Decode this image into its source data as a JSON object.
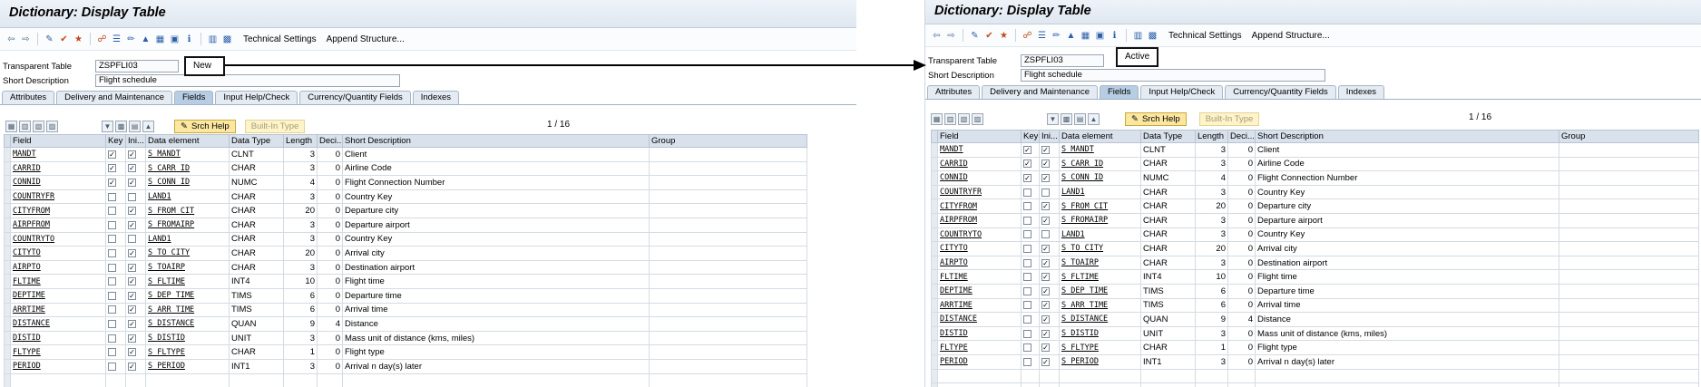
{
  "window_title": "Dictionary: Display Table",
  "toolbar": {
    "technical_settings": "Technical Settings",
    "append_structure": "Append Structure..."
  },
  "header": {
    "transparent_table_label": "Transparent Table",
    "table_name": "ZSPFLI03",
    "short_description_label": "Short Description",
    "short_description": "Flight schedule"
  },
  "status": {
    "left": "New",
    "right": "Active"
  },
  "tabs": [
    "Attributes",
    "Delivery and Maintenance",
    "Fields",
    "Input Help/Check",
    "Currency/Quantity Fields",
    "Indexes"
  ],
  "active_tab": "Fields",
  "buttons": {
    "srch_help": "Srch Help",
    "built_in_type": "Built-In Type"
  },
  "pager": "1  /  16",
  "columns": [
    "Field",
    "Key",
    "Ini...",
    "Data element",
    "Data Type",
    "Length",
    "Deci...",
    "Short Description",
    "Group"
  ],
  "left_rows": [
    {
      "field": "MANDT",
      "key": true,
      "ini": true,
      "de": "S_MANDT",
      "type": "CLNT",
      "len": "3",
      "dec": "0",
      "desc": "Client"
    },
    {
      "field": "CARRID",
      "key": true,
      "ini": true,
      "de": "S_CARR_ID",
      "type": "CHAR",
      "len": "3",
      "dec": "0",
      "desc": "Airline Code"
    },
    {
      "field": "CONNID",
      "key": true,
      "ini": true,
      "de": "S_CONN_ID",
      "type": "NUMC",
      "len": "4",
      "dec": "0",
      "desc": "Flight Connection Number"
    },
    {
      "field": "COUNTRYFR",
      "key": false,
      "ini": false,
      "de": "LAND1",
      "type": "CHAR",
      "len": "3",
      "dec": "0",
      "desc": "Country Key"
    },
    {
      "field": "CITYFROM",
      "key": false,
      "ini": true,
      "de": "S_FROM_CIT",
      "type": "CHAR",
      "len": "20",
      "dec": "0",
      "desc": "Departure city"
    },
    {
      "field": "AIRPFROM",
      "key": false,
      "ini": true,
      "de": "S_FROMAIRP",
      "type": "CHAR",
      "len": "3",
      "dec": "0",
      "desc": "Departure airport"
    },
    {
      "field": "COUNTRYTO",
      "key": false,
      "ini": false,
      "de": "LAND1",
      "type": "CHAR",
      "len": "3",
      "dec": "0",
      "desc": "Country Key"
    },
    {
      "field": "CITYTO",
      "key": false,
      "ini": true,
      "de": "S_TO_CITY",
      "type": "CHAR",
      "len": "20",
      "dec": "0",
      "desc": "Arrival city"
    },
    {
      "field": "AIRPTO",
      "key": false,
      "ini": true,
      "de": "S_TOAIRP",
      "type": "CHAR",
      "len": "3",
      "dec": "0",
      "desc": "Destination airport"
    },
    {
      "field": "FLTIME",
      "key": false,
      "ini": true,
      "de": "S_FLTIME",
      "type": "INT4",
      "len": "10",
      "dec": "0",
      "desc": "Flight time"
    },
    {
      "field": "DEPTIME",
      "key": false,
      "ini": true,
      "de": "S_DEP_TIME",
      "type": "TIMS",
      "len": "6",
      "dec": "0",
      "desc": "Departure time"
    },
    {
      "field": "ARRTIME",
      "key": false,
      "ini": true,
      "de": "S_ARR_TIME",
      "type": "TIMS",
      "len": "6",
      "dec": "0",
      "desc": "Arrival time"
    },
    {
      "field": "DISTANCE",
      "key": false,
      "ini": true,
      "de": "S_DISTANCE",
      "type": "QUAN",
      "len": "9",
      "dec": "4",
      "desc": "Distance"
    },
    {
      "field": "DISTID",
      "key": false,
      "ini": true,
      "de": "S_DISTID",
      "type": "UNIT",
      "len": "3",
      "dec": "0",
      "desc": "Mass unit of distance (kms, miles)"
    },
    {
      "field": "FLTYPE",
      "key": false,
      "ini": true,
      "de": "S_FLTYPE",
      "type": "CHAR",
      "len": "1",
      "dec": "0",
      "desc": "Flight type"
    },
    {
      "field": "PERIOD",
      "key": false,
      "ini": true,
      "de": "S_PERIOD",
      "type": "INT1",
      "len": "3",
      "dec": "0",
      "desc": "Arrival n day(s) later"
    }
  ],
  "right_rows": [
    {
      "field": "MANDT",
      "key": true,
      "ini": true,
      "de": "S_MANDT",
      "type": "CLNT",
      "len": "3",
      "dec": "0",
      "desc": "Client"
    },
    {
      "field": "CARRID",
      "key": true,
      "ini": true,
      "de": "S_CARR_ID",
      "type": "CHAR",
      "len": "3",
      "dec": "0",
      "desc": "Airline Code"
    },
    {
      "field": "CONNID",
      "key": true,
      "ini": true,
      "de": "S_CONN_ID",
      "type": "NUMC",
      "len": "4",
      "dec": "0",
      "desc": "Flight Connection Number"
    },
    {
      "field": "COUNTRYFR",
      "key": false,
      "ini": false,
      "de": "LAND1",
      "type": "CHAR",
      "len": "3",
      "dec": "0",
      "desc": "Country Key"
    },
    {
      "field": "CITYFROM",
      "key": false,
      "ini": true,
      "de": "S_FROM_CIT",
      "type": "CHAR",
      "len": "20",
      "dec": "0",
      "desc": "Departure city"
    },
    {
      "field": "AIRPFROM",
      "key": false,
      "ini": true,
      "de": "S_FROMAIRP",
      "type": "CHAR",
      "len": "3",
      "dec": "0",
      "desc": "Departure airport"
    },
    {
      "field": "COUNTRYTO",
      "key": false,
      "ini": false,
      "de": "LAND1",
      "type": "CHAR",
      "len": "3",
      "dec": "0",
      "desc": "Country Key"
    },
    {
      "field": "CITYTO",
      "key": false,
      "ini": true,
      "de": "S_TO_CITY",
      "type": "CHAR",
      "len": "20",
      "dec": "0",
      "desc": "Arrival city"
    },
    {
      "field": "AIRPTO",
      "key": false,
      "ini": true,
      "de": "S_TOAIRP",
      "type": "CHAR",
      "len": "3",
      "dec": "0",
      "desc": "Destination airport"
    },
    {
      "field": "FLTIME",
      "key": false,
      "ini": true,
      "de": "S_FLTIME",
      "type": "INT4",
      "len": "10",
      "dec": "0",
      "desc": "Flight time"
    },
    {
      "field": "DEPTIME",
      "key": false,
      "ini": true,
      "de": "S_DEP_TIME",
      "type": "TIMS",
      "len": "6",
      "dec": "0",
      "desc": "Departure time"
    },
    {
      "field": "ARRTIME",
      "key": false,
      "ini": true,
      "de": "S_ARR_TIME",
      "type": "TIMS",
      "len": "6",
      "dec": "0",
      "desc": "Arrival time"
    },
    {
      "field": "DISTANCE",
      "key": false,
      "ini": true,
      "de": "S_DISTANCE",
      "type": "QUAN",
      "len": "9",
      "dec": "4",
      "desc": "Distance"
    },
    {
      "field": "DISTID",
      "key": false,
      "ini": true,
      "de": "S_DISTID",
      "type": "UNIT",
      "len": "3",
      "dec": "0",
      "desc": "Mass unit of distance (kms, miles)"
    },
    {
      "field": "FLTYPE",
      "key": false,
      "ini": true,
      "de": "S_FLTYPE",
      "type": "CHAR",
      "len": "1",
      "dec": "0",
      "desc": "Flight type"
    },
    {
      "field": "PERIOD",
      "key": false,
      "ini": true,
      "de": "S_PERIOD",
      "type": "INT1",
      "len": "3",
      "dec": "0",
      "desc": "Arrival n day(s) later"
    }
  ],
  "colors": {
    "title_bg": "#dfe7f0",
    "tab_active": "#b7cde3",
    "button_yellow": "#fbe7a0",
    "header_row": "#d9e2ec"
  }
}
